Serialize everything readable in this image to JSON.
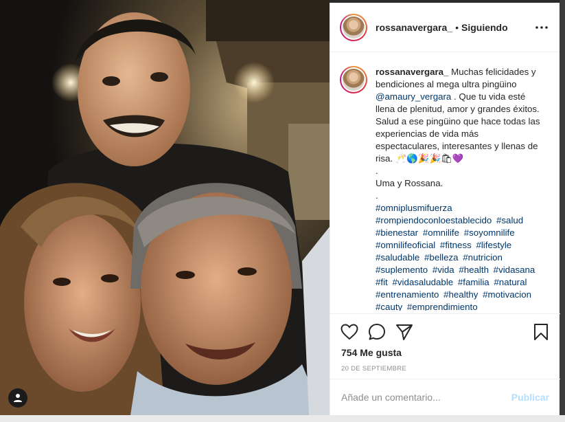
{
  "post": {
    "username": "rossanavergara_",
    "separator": "•",
    "follow_status": "Siguiendo",
    "caption": {
      "username": "rossanavergara_",
      "intro": "Muchas felicidades y bendiciones al mega ultra pingüino",
      "mention": "@amaury_vergara",
      "body": ". Que tu vida esté llena de plenitud, amor y grandes éxitos. Salud a ese pingüino que hace todas las experiencias de vida más espectaculares, interesantes y llenas de risa. 🥂🌎🎉🎉🛍💜",
      "dot1": ".",
      "sign": "Uma y Rossana.",
      "dot2": ".",
      "hashtags": [
        "#omniplusmifuerza",
        "#rompiendoconloestablecido",
        "#salud",
        "#bienestar",
        "#omnilife",
        "#soyomnilife",
        "#omnilifeoficial",
        "#fitness",
        "#lifestyle",
        "#saludable",
        "#belleza",
        "#nutricion",
        "#suplemento",
        "#vida",
        "#health",
        "#vidasana",
        "#fit",
        "#vidasaludable",
        "#familia",
        "#natural",
        "#entrenamiento",
        "#healthy",
        "#motivacion",
        "#cauty",
        "#emprendimiento"
      ]
    },
    "likes": "754 Me gusta",
    "date": "20 DE SEPTIEMBRE",
    "comment_placeholder": "Añade un comentario...",
    "publish_label": "Publicar"
  },
  "icons": {
    "more": "more-options-icon",
    "like": "heart-icon",
    "comment": "comment-icon",
    "share": "share-icon",
    "save": "bookmark-icon",
    "user_tag": "user-tag-icon"
  },
  "colors": {
    "link": "#00376b",
    "text": "#262626",
    "muted": "#8e8e8e",
    "publish_disabled": "#b2dffc"
  }
}
